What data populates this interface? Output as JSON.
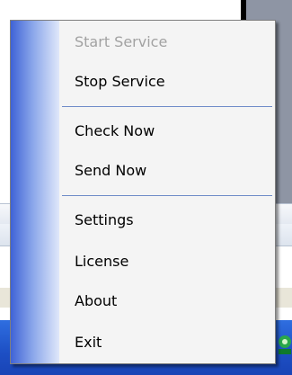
{
  "menu": {
    "items": [
      {
        "label": "Start Service",
        "enabled": false
      },
      {
        "label": "Stop Service",
        "enabled": true
      },
      {
        "label": "Check Now",
        "enabled": true
      },
      {
        "label": "Send Now",
        "enabled": true
      },
      {
        "label": "Settings",
        "enabled": true
      },
      {
        "label": "License",
        "enabled": true
      },
      {
        "label": "About",
        "enabled": true
      },
      {
        "label": "Exit",
        "enabled": true
      }
    ]
  },
  "colors": {
    "menu_background": "#f4f4f4",
    "disabled_text": "#a2a2a2",
    "separator": "#6f8cc8",
    "taskbar": "#1d4fc4"
  }
}
